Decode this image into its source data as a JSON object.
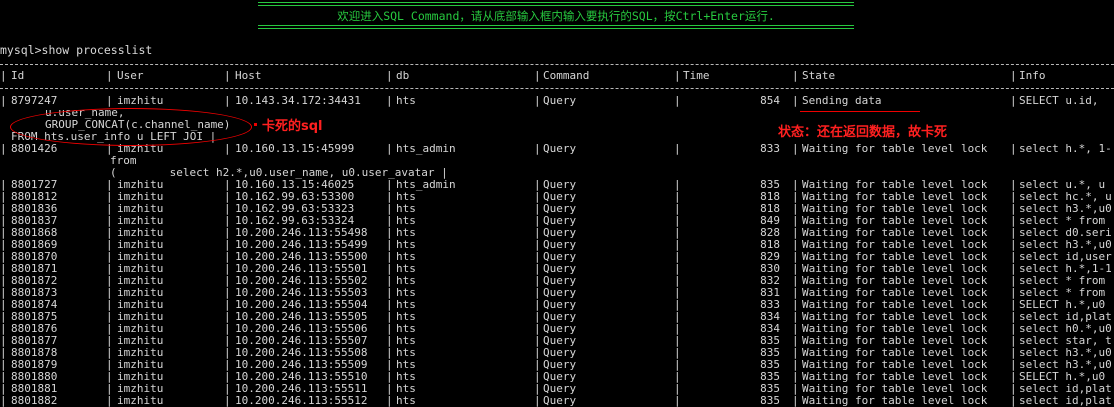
{
  "banner": {
    "text": "欢迎进入SQL Command，请从底部输入框内输入要执行的SQL，按Ctrl+Enter运行."
  },
  "prompt": "mysql>show processlist",
  "table": {
    "headers": [
      {
        "key": "id",
        "label": "Id"
      },
      {
        "key": "user",
        "label": "User"
      },
      {
        "key": "host",
        "label": "Host"
      },
      {
        "key": "db",
        "label": "db"
      },
      {
        "key": "command",
        "label": "Command"
      },
      {
        "key": "time",
        "label": "Time"
      },
      {
        "key": "state",
        "label": "State"
      },
      {
        "key": "info",
        "label": "Info"
      }
    ],
    "row1": {
      "id": "8797247",
      "user": "imzhitu",
      "host": "10.143.34.172:34431",
      "db": "hts",
      "command": "Query",
      "time": "854",
      "state": "Sending data",
      "info": "SELECT u.id,",
      "info_cont": [
        "u.user_name,",
        "GROUP_CONCAT(c.channel_name)",
        "FROM hts.user_info u LEFT JOI |"
      ]
    },
    "row2": {
      "id": "8801426",
      "user": "imzhitu",
      "host": "10.160.13.15:45999",
      "db": "hts_admin",
      "command": "Query",
      "time": "833",
      "state": "Waiting for table level lock",
      "info": "select h.*, 1-",
      "info_cont": [
        "from",
        "(        select h2.*,u0.user_name, u0.user_avatar |"
      ]
    },
    "rows": [
      {
        "id": "8801727",
        "user": "imzhitu",
        "host": "10.160.13.15:46025",
        "db": "hts_admin",
        "command": "Query",
        "time": "835",
        "state": "Waiting for table level lock",
        "info": "select u.*, u"
      },
      {
        "id": "8801812",
        "user": "imzhitu",
        "host": "10.162.99.63:53300",
        "db": "hts",
        "command": "Query",
        "time": "818",
        "state": "Waiting for table level lock",
        "info": "select hc.*, u"
      },
      {
        "id": "8801836",
        "user": "imzhitu",
        "host": "10.162.99.63:53323",
        "db": "hts",
        "command": "Query",
        "time": "818",
        "state": "Waiting for table level lock",
        "info": "select h3.*,u0"
      },
      {
        "id": "8801837",
        "user": "imzhitu",
        "host": "10.162.99.63:53324",
        "db": "hts",
        "command": "Query",
        "time": "849",
        "state": "Waiting for table level lock",
        "info": "select * from"
      },
      {
        "id": "8801868",
        "user": "imzhitu",
        "host": "10.200.246.113:55498",
        "db": "hts",
        "command": "Query",
        "time": "828",
        "state": "Waiting for table level lock",
        "info": "select d0.seri"
      },
      {
        "id": "8801869",
        "user": "imzhitu",
        "host": "10.200.246.113:55499",
        "db": "hts",
        "command": "Query",
        "time": "818",
        "state": "Waiting for table level lock",
        "info": "select h3.*,u0"
      },
      {
        "id": "8801870",
        "user": "imzhitu",
        "host": "10.200.246.113:55500",
        "db": "hts",
        "command": "Query",
        "time": "829",
        "state": "Waiting for table level lock",
        "info": "select id,user"
      },
      {
        "id": "8801871",
        "user": "imzhitu",
        "host": "10.200.246.113:55501",
        "db": "hts",
        "command": "Query",
        "time": "830",
        "state": "Waiting for table level lock",
        "info": "select h.*,1-1"
      },
      {
        "id": "8801872",
        "user": "imzhitu",
        "host": "10.200.246.113:55502",
        "db": "hts",
        "command": "Query",
        "time": "832",
        "state": "Waiting for table level lock",
        "info": "select * from"
      },
      {
        "id": "8801873",
        "user": "imzhitu",
        "host": "10.200.246.113:55503",
        "db": "hts",
        "command": "Query",
        "time": "831",
        "state": "Waiting for table level lock",
        "info": "select * from"
      },
      {
        "id": "8801874",
        "user": "imzhitu",
        "host": "10.200.246.113:55504",
        "db": "hts",
        "command": "Query",
        "time": "833",
        "state": "Waiting for table level lock",
        "info": "SELECT h.*,u0"
      },
      {
        "id": "8801875",
        "user": "imzhitu",
        "host": "10.200.246.113:55505",
        "db": "hts",
        "command": "Query",
        "time": "834",
        "state": "Waiting for table level lock",
        "info": "select id,plat"
      },
      {
        "id": "8801876",
        "user": "imzhitu",
        "host": "10.200.246.113:55506",
        "db": "hts",
        "command": "Query",
        "time": "834",
        "state": "Waiting for table level lock",
        "info": "select h0.*,u0"
      },
      {
        "id": "8801877",
        "user": "imzhitu",
        "host": "10.200.246.113:55507",
        "db": "hts",
        "command": "Query",
        "time": "835",
        "state": "Waiting for table level lock",
        "info": "select star, t"
      },
      {
        "id": "8801878",
        "user": "imzhitu",
        "host": "10.200.246.113:55508",
        "db": "hts",
        "command": "Query",
        "time": "835",
        "state": "Waiting for table level lock",
        "info": "select h3.*,u0"
      },
      {
        "id": "8801879",
        "user": "imzhitu",
        "host": "10.200.246.113:55509",
        "db": "hts",
        "command": "Query",
        "time": "835",
        "state": "Waiting for table level lock",
        "info": "select h3.*,u0"
      },
      {
        "id": "8801880",
        "user": "imzhitu",
        "host": "10.200.246.113:55510",
        "db": "hts",
        "command": "Query",
        "time": "835",
        "state": "Waiting for table level lock",
        "info": "SELECT h.*,u0"
      },
      {
        "id": "8801881",
        "user": "imzhitu",
        "host": "10.200.246.113:55511",
        "db": "hts",
        "command": "Query",
        "time": "835",
        "state": "Waiting for table level lock",
        "info": "select id,plat"
      },
      {
        "id": "8801882",
        "user": "imzhitu",
        "host": "10.200.246.113:55512",
        "db": "hts",
        "command": "Query",
        "time": "835",
        "state": "Waiting for table level lock",
        "info": "select id,plat"
      }
    ]
  },
  "annotations": {
    "stuck_sql": "卡死的sql",
    "state_note": "状态：还在返回数据，故卡死"
  },
  "colors": {
    "banner_green": "#27c93f",
    "annotation_red": "#ff2020",
    "background": "#000000"
  }
}
